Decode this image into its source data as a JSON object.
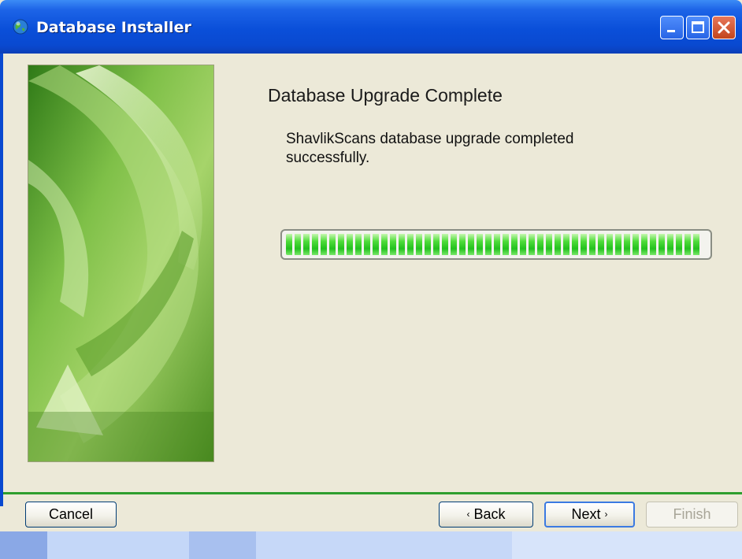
{
  "window": {
    "title": "Database Installer",
    "icons": {
      "app": "globe-icon",
      "minimize": "minimize-icon",
      "maximize": "maximize-icon",
      "close": "close-icon"
    }
  },
  "page": {
    "heading": "Database Upgrade Complete",
    "message": "ShavlikScans database upgrade completed successfully."
  },
  "progress": {
    "value_percent": 100,
    "color": "#23c11e"
  },
  "buttons": {
    "cancel": "Cancel",
    "back": "Back",
    "next": "Next",
    "finish": "Finish",
    "back_arrow": "‹",
    "next_arrow": "›"
  },
  "colors": {
    "titlebar": "#0a4fd9",
    "separator": "#2e9e2e",
    "window_bg": "#ece9d8"
  }
}
